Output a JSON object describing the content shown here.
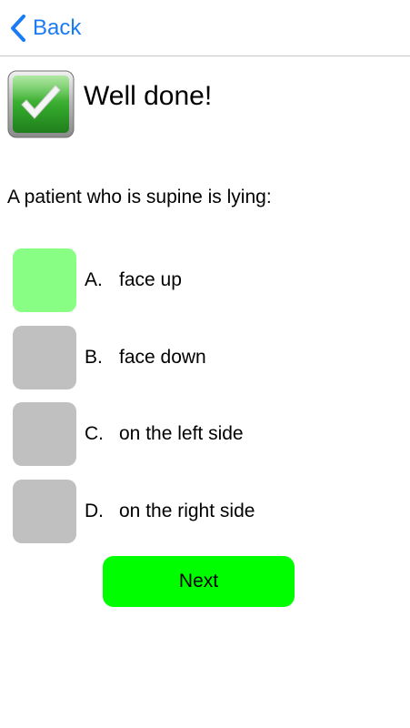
{
  "colors": {
    "accent": "#1a7cf5",
    "selected": "#88fe84",
    "neutral": "#c0c0c0",
    "next": "#00fe00"
  },
  "navbar": {
    "back_icon": "chevron-left-icon",
    "back_label": "Back"
  },
  "result": {
    "icon": "checkmark-icon",
    "title": "Well done!"
  },
  "question": {
    "text": "A patient who is supine is lying:"
  },
  "options": [
    {
      "letter": "A.",
      "text": "face up",
      "selected": true
    },
    {
      "letter": "B.",
      "text": "face down",
      "selected": false
    },
    {
      "letter": "C.",
      "text": "on the left side",
      "selected": false
    },
    {
      "letter": "D.",
      "text": "on the right side",
      "selected": false
    }
  ],
  "next_button": {
    "label": "Next"
  }
}
